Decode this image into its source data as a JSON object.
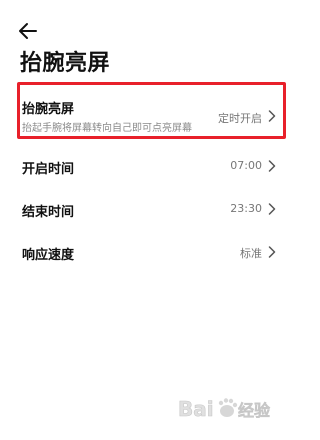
{
  "header": {
    "back_icon": "arrow-left-icon",
    "title": "抬腕亮屏"
  },
  "settings": {
    "raise_to_wake": {
      "label": "抬腕亮屏",
      "description": "抬起手腕将屏幕转向自己即可点亮屏幕",
      "value": "定时开启"
    },
    "start_time": {
      "label": "开启时间",
      "value": "07:00"
    },
    "end_time": {
      "label": "结束时间",
      "value": "23:30"
    },
    "response_speed": {
      "label": "响应速度",
      "value": "标准"
    }
  },
  "overlay": {
    "highlight_color": "#e8202a",
    "watermark_text": "Baidu 经验"
  },
  "colors": {
    "text_primary": "#111111",
    "text_secondary": "#8a8a8a",
    "value_text": "#777777",
    "background": "#ffffff"
  }
}
